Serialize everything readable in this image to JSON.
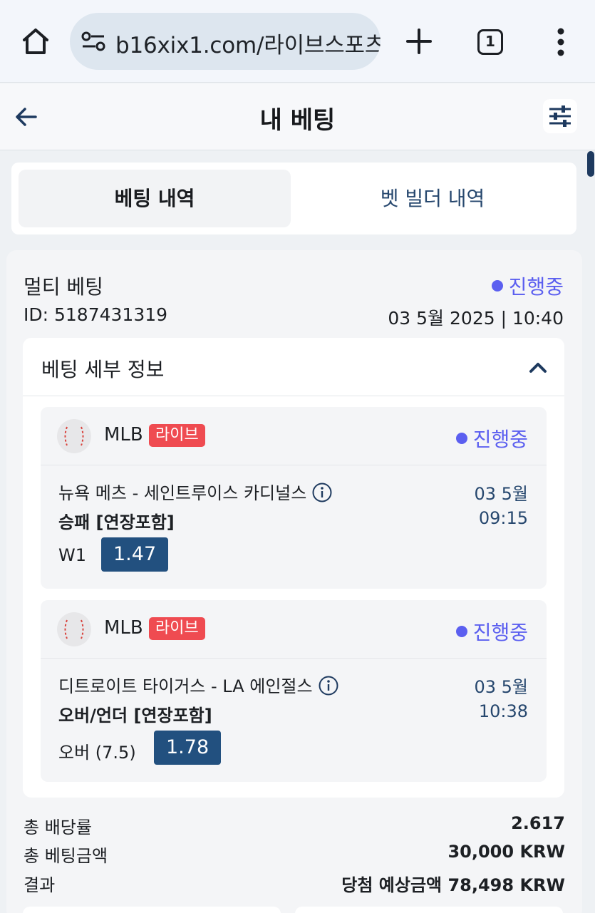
{
  "browser": {
    "url": "b16xix1.com/라이브스포츠",
    "tab_count": "1"
  },
  "header": {
    "title": "내 베팅"
  },
  "tabs": [
    {
      "label": "베팅 내역",
      "active": true
    },
    {
      "label": "벳 빌더 내역",
      "active": false
    }
  ],
  "bet": {
    "type": "멀티 베팅",
    "status": "진행중",
    "id": "ID: 5187431319",
    "date": "03 5월 2025 | 10:40",
    "details_title": "베팅 세부 정보",
    "selections": [
      {
        "league": "MLB",
        "badge": "라이브",
        "status": "진행중",
        "match": "뉴욕 메츠 - 세인트루이스 카디널스",
        "date": "03 5월",
        "time": "09:15",
        "market": "승패 [연장포함]",
        "pick": "W1",
        "odds": "1.47"
      },
      {
        "league": "MLB",
        "badge": "라이브",
        "status": "진행중",
        "match": "디트로이트 타이거스 - LA 에인절스",
        "date": "03 5월",
        "time": "10:38",
        "market": "오버/언더 [연장포함]",
        "pick": "오버 (7.5)",
        "odds": "1.78"
      }
    ],
    "summary": {
      "total_odds_label": "총 배당률",
      "total_odds": "2.617",
      "stake_label": "총 베팅금액",
      "stake": "30,000 KRW",
      "result_label": "결과",
      "result": "당첨 예상금액 78,498 KRW"
    }
  },
  "colors": {
    "accent_status": "#5b5ff0",
    "odds_badge": "#22507f",
    "live_badge": "#ef4b51",
    "link_blue": "#26476e"
  },
  "icons": [
    "home-icon",
    "site-settings-icon",
    "plus-icon",
    "more-vert-icon",
    "back-arrow-icon",
    "filter-icon",
    "chevron-up-icon",
    "baseball-icon",
    "info-icon"
  ]
}
